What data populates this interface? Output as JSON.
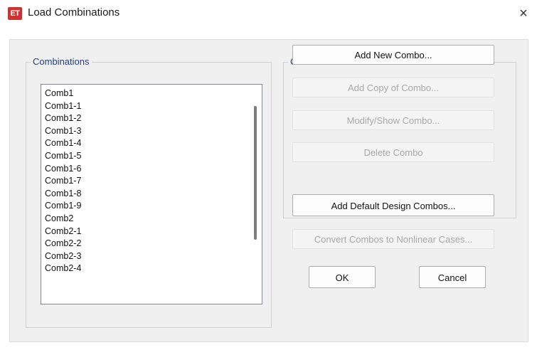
{
  "window": {
    "app_icon_text": "ET",
    "title": "Load Combinations",
    "close_glyph": "×"
  },
  "combinations": {
    "group_label": "Combinations",
    "items": [
      "Comb1",
      "Comb1-1",
      "Comb1-2",
      "Comb1-3",
      "Comb1-4",
      "Comb1-5",
      "Comb1-6",
      "Comb1-7",
      "Comb1-8",
      "Comb1-9",
      "Comb2",
      "Comb2-1",
      "Comb2-2",
      "Comb2-3",
      "Comb2-4"
    ]
  },
  "click_to": {
    "group_label": "Click to:",
    "add_new": "Add New Combo...",
    "add_copy": "Add Copy of Combo...",
    "modify_show": "Modify/Show Combo...",
    "delete": "Delete Combo"
  },
  "buttons": {
    "add_default": "Add Default Design Combos...",
    "convert": "Convert Combos to Nonlinear Cases...",
    "ok": "OK",
    "cancel": "Cancel"
  },
  "colors": {
    "group_label": "#1f3d8c",
    "app_icon": "#d32f2f",
    "disabled_text": "#a8a8a8"
  }
}
